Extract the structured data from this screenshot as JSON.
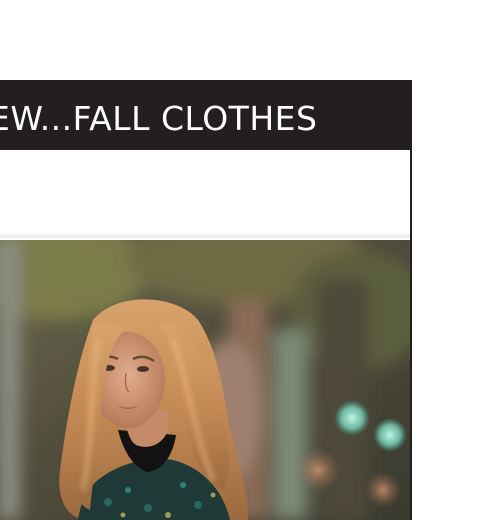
{
  "header": {
    "title": "EW...FALL CLOTHES"
  },
  "photo": {
    "subject": "woman with long wavy blonde hair wearing a dark turtleneck and green patterned coat, blurred city street background"
  },
  "colors": {
    "header_background": "#231f20",
    "header_text": "#ffffff",
    "page_background": "#ffffff"
  }
}
